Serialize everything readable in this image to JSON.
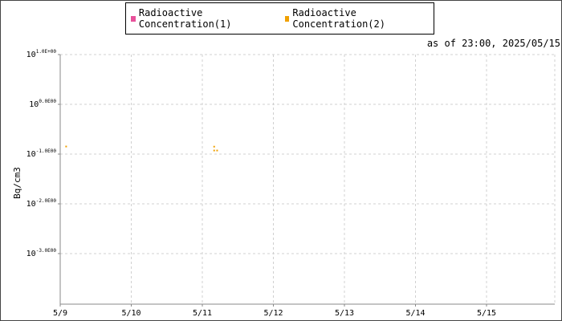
{
  "legend": {
    "series1_label": "Radioactive Concentration(1)",
    "series2_label": "Radioactive Concentration(2)",
    "series1_color": "#e8509a",
    "series2_color": "#f0a000"
  },
  "asof": "as of 23:00, 2025/05/15",
  "chart_data": {
    "type": "scatter",
    "ylabel": "Bq/cm3",
    "y_scale": "log",
    "ylim": [
      0.0001,
      10
    ],
    "y_ticks": [
      {
        "base": "10",
        "exp": "1.0E+00"
      },
      {
        "base": "10",
        "exp": "0.0E00"
      },
      {
        "base": "10",
        "exp": "-1.0E00"
      },
      {
        "base": "10",
        "exp": "-2.0E00"
      },
      {
        "base": "10",
        "exp": "-3.0E00"
      }
    ],
    "x_ticks": [
      "5/9",
      "5/10",
      "5/11",
      "5/12",
      "5/13",
      "5/14",
      "5/15"
    ],
    "x_range": [
      "2025-05-09",
      "2025-05-15 23:00"
    ],
    "grid": true,
    "legend_position": "top",
    "series": [
      {
        "name": "Radioactive Concentration(1)",
        "color": "#e8509a",
        "points": []
      },
      {
        "name": "Radioactive Concentration(2)",
        "color": "#f0a000",
        "points": [
          {
            "x": "2025-05-09 02:00",
            "y": 0.142
          },
          {
            "x": "2025-05-11 04:00",
            "y": 0.141
          },
          {
            "x": "2025-05-11 04:00",
            "y": 0.118
          },
          {
            "x": "2025-05-11 05:00",
            "y": 0.118
          }
        ]
      }
    ]
  }
}
